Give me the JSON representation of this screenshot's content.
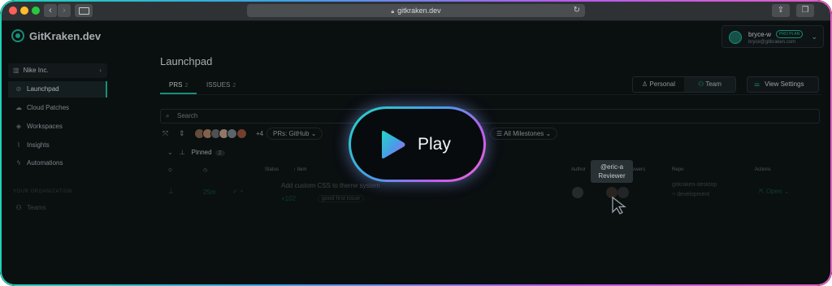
{
  "browser": {
    "url": "gitkraken.dev",
    "back": "‹",
    "forward": "›"
  },
  "app": {
    "brand": "GitKraken.dev",
    "user": {
      "name": "bryce-w",
      "plan": "PRO PLAN",
      "email": "bryce@gitkraken.com"
    }
  },
  "sidebar": {
    "org": "Nike Inc.",
    "items": [
      {
        "label": "Launchpad",
        "icon": "rocket-icon"
      },
      {
        "label": "Cloud Patches",
        "icon": "cloud-icon"
      },
      {
        "label": "Workspaces",
        "icon": "layers-icon"
      },
      {
        "label": "Insights",
        "icon": "chart-icon"
      },
      {
        "label": "Automations",
        "icon": "bolt-icon"
      }
    ],
    "section_label": "YOUR ORGANIZATION",
    "team_item": "Teams"
  },
  "main": {
    "title": "Launchpad",
    "tabs": [
      {
        "label": "PRS",
        "count": "2"
      },
      {
        "label": "ISSUES",
        "count": "2"
      }
    ],
    "view_toggle": {
      "personal": "Personal",
      "team": "Team"
    },
    "view_settings": "View Settings",
    "search_placeholder": "Search",
    "filters": {
      "avatars_more": "+4",
      "prs_source": "PRs: GitHub",
      "milestones": "All Milestones"
    },
    "pinned": {
      "label": "Pinned",
      "count": "2"
    },
    "columns": [
      "Status",
      "Item",
      "Author",
      "Reviewers",
      "Repo",
      "Actions"
    ],
    "rows": [
      {
        "age": "25m",
        "title": "Add custom CSS to theme system",
        "diff": "+102",
        "label": "good first issue",
        "repo": "gitkraken-desktop",
        "branch": "development",
        "action": "Open"
      }
    ],
    "tooltip": {
      "user": "@eric-a",
      "role": "Reviewer"
    }
  },
  "overlay": {
    "play_label": "Play"
  },
  "colors": {
    "accent": "#1fc6a6",
    "background": "#0f1517",
    "gradient_start": "#21d7c2",
    "gradient_end": "#f06ad2"
  }
}
